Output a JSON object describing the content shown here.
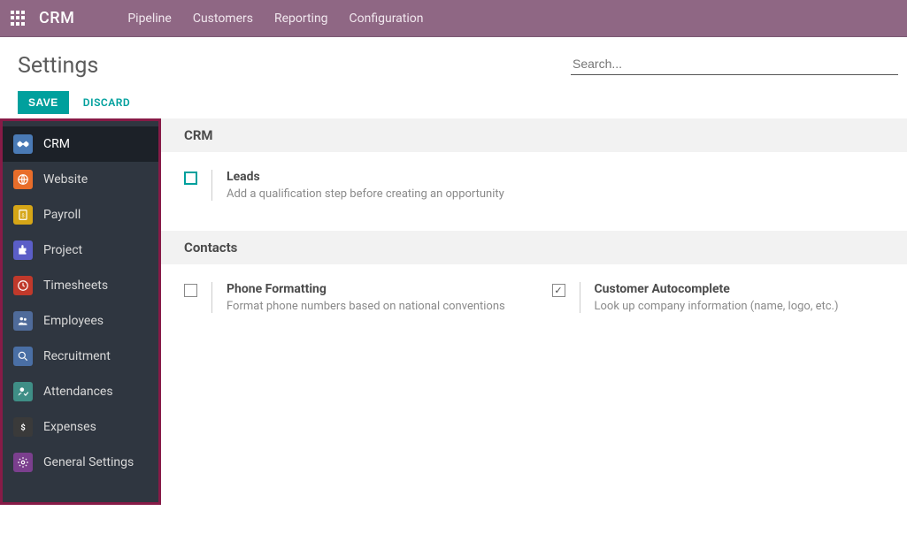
{
  "topnav": {
    "brand": "CRM",
    "menu": [
      "Pipeline",
      "Customers",
      "Reporting",
      "Configuration"
    ]
  },
  "header": {
    "title": "Settings",
    "search_placeholder": "Search...",
    "save_label": "SAVE",
    "discard_label": "DISCARD"
  },
  "sidebar": {
    "items": [
      {
        "label": "CRM",
        "color": "#4a7ab5",
        "icon": "handshake",
        "active": true
      },
      {
        "label": "Website",
        "color": "#e86d2a",
        "icon": "globe",
        "active": false
      },
      {
        "label": "Payroll",
        "color": "#d6a617",
        "icon": "dollar-doc",
        "active": false
      },
      {
        "label": "Project",
        "color": "#5b5ec7",
        "icon": "puzzle",
        "active": false
      },
      {
        "label": "Timesheets",
        "color": "#c0392b",
        "icon": "clock",
        "active": false
      },
      {
        "label": "Employees",
        "color": "#4f6b9a",
        "icon": "users",
        "active": false
      },
      {
        "label": "Recruitment",
        "color": "#4a6fa5",
        "icon": "search-user",
        "active": false
      },
      {
        "label": "Attendances",
        "color": "#3f8e86",
        "icon": "check-user",
        "active": false
      },
      {
        "label": "Expenses",
        "color": "#3a3a3a",
        "icon": "dollar",
        "active": false
      },
      {
        "label": "General Settings",
        "color": "#7b3f8e",
        "icon": "gear",
        "active": false
      }
    ]
  },
  "sections": [
    {
      "title": "CRM",
      "settings": [
        {
          "checked": false,
          "style": "teal",
          "title": "Leads",
          "desc": "Add a qualification step before creating an opportunity"
        }
      ]
    },
    {
      "title": "Contacts",
      "settings": [
        {
          "checked": false,
          "style": "plain",
          "title": "Phone Formatting",
          "desc": "Format phone numbers based on national conventions"
        },
        {
          "checked": true,
          "style": "plain",
          "title": "Customer Autocomplete",
          "desc": "Look up company information (name, logo, etc.)"
        }
      ]
    }
  ]
}
